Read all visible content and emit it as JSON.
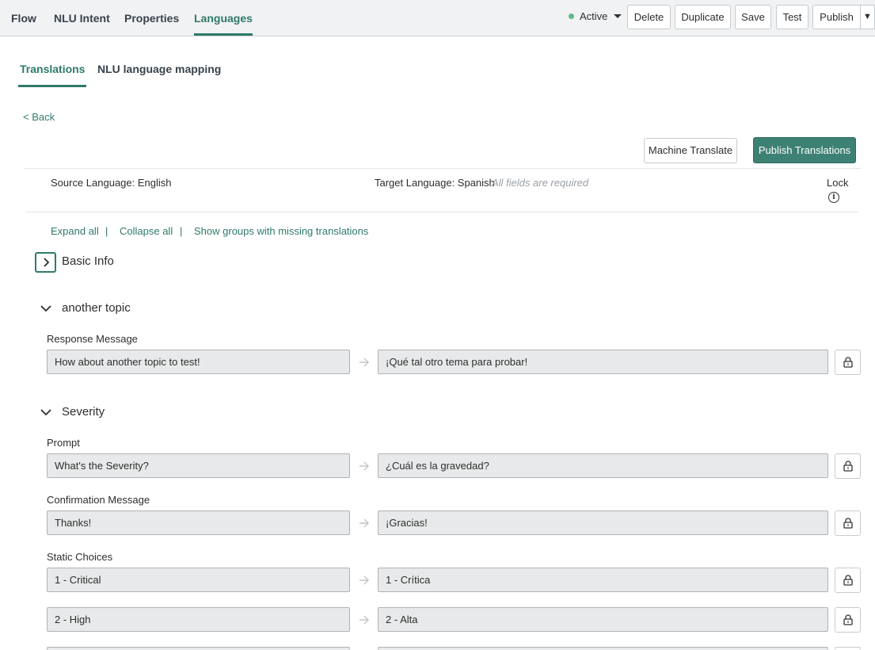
{
  "topbar": {
    "tabs": [
      {
        "label": "Flow"
      },
      {
        "label": "NLU Intent"
      },
      {
        "label": "Properties"
      },
      {
        "label": "Languages"
      }
    ],
    "status": "Active",
    "buttons": {
      "delete": "Delete",
      "duplicate": "Duplicate",
      "save": "Save",
      "test": "Test",
      "publish": "Publish"
    },
    "publish_caret": "▼"
  },
  "subtabs": [
    {
      "label": "Translations"
    },
    {
      "label": "NLU language mapping"
    }
  ],
  "back_label": "< Back",
  "actions": {
    "machine_translate": "Machine Translate",
    "publish_translations": "Publish Translations"
  },
  "header": {
    "source_language": "Source Language: English",
    "target_language": "Target Language: Spanish",
    "required_hint": "All fields are required",
    "lock_label": "Lock",
    "info_glyph": "i"
  },
  "links": {
    "expand_all": "Expand all",
    "collapse_all": "Collapse all",
    "show_missing": "Show groups with missing translations",
    "separator": "|"
  },
  "groups": [
    {
      "title": "Basic Info",
      "expanded": false
    },
    {
      "title": "another topic",
      "expanded": true,
      "fields": [
        {
          "label": "Response Message",
          "rows": [
            {
              "source": "How about another topic to test!",
              "target": "¡Qué tal otro tema para probar!"
            }
          ]
        }
      ]
    },
    {
      "title": "Severity",
      "expanded": true,
      "fields": [
        {
          "label": "Prompt",
          "rows": [
            {
              "source": "What's the Severity?",
              "target": "¿Cuál es la gravedad?"
            }
          ]
        },
        {
          "label": "Confirmation Message",
          "rows": [
            {
              "source": "Thanks!",
              "target": "¡Gracias!"
            }
          ]
        },
        {
          "label": "Static Choices",
          "rows": [
            {
              "source": "1 - Critical",
              "target": "1 - Crítica"
            },
            {
              "source": "2 - High",
              "target": "2 - Alta"
            }
          ]
        }
      ]
    }
  ],
  "colors": {
    "accent": "#2f7a6b",
    "primary_button": "#3d8174",
    "status_active": "#5cba8e",
    "field_bg": "#e8e9ea"
  }
}
